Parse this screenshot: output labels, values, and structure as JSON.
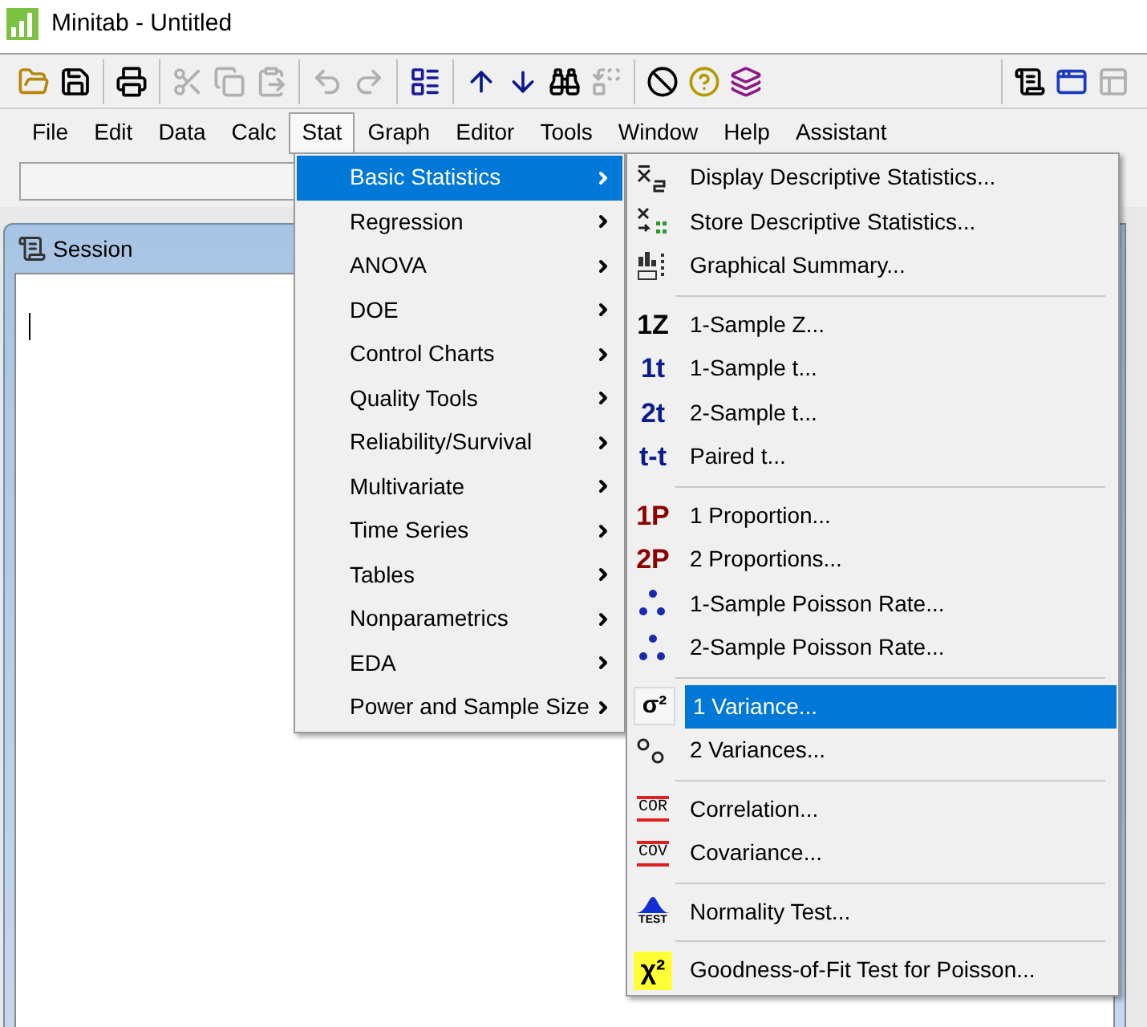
{
  "window": {
    "title": "Minitab - Untitled"
  },
  "toolbar": [
    {
      "kind": "open",
      "disabled": false
    },
    {
      "kind": "save",
      "disabled": false
    },
    {
      "kind": "sep"
    },
    {
      "kind": "print",
      "disabled": false
    },
    {
      "kind": "sep"
    },
    {
      "kind": "cut",
      "disabled": true
    },
    {
      "kind": "copy",
      "disabled": true
    },
    {
      "kind": "paste",
      "disabled": true
    },
    {
      "kind": "sep"
    },
    {
      "kind": "undo",
      "disabled": true
    },
    {
      "kind": "redo",
      "disabled": true
    },
    {
      "kind": "sep"
    },
    {
      "kind": "sheet",
      "disabled": false
    },
    {
      "kind": "sep"
    },
    {
      "kind": "up",
      "disabled": false
    },
    {
      "kind": "down",
      "disabled": false
    },
    {
      "kind": "find",
      "disabled": false
    },
    {
      "kind": "replace",
      "disabled": true
    },
    {
      "kind": "sep"
    },
    {
      "kind": "cancel",
      "disabled": false
    },
    {
      "kind": "help",
      "disabled": false
    },
    {
      "kind": "stack",
      "disabled": false
    }
  ],
  "toolbar_right": [
    {
      "kind": "session",
      "disabled": false
    },
    {
      "kind": "windows",
      "disabled": false
    },
    {
      "kind": "graphs",
      "disabled": true
    }
  ],
  "menubar": [
    {
      "label": "File",
      "selected": false
    },
    {
      "label": "Edit",
      "selected": false
    },
    {
      "label": "Data",
      "selected": false
    },
    {
      "label": "Calc",
      "selected": false
    },
    {
      "label": "Stat",
      "selected": true
    },
    {
      "label": "Graph",
      "selected": false
    },
    {
      "label": "Editor",
      "selected": false
    },
    {
      "label": "Tools",
      "selected": false
    },
    {
      "label": "Window",
      "selected": false
    },
    {
      "label": "Help",
      "selected": false
    },
    {
      "label": "Assistant",
      "selected": false
    }
  ],
  "session": {
    "title": "Session"
  },
  "stat_menu": [
    {
      "label": "Basic Statistics",
      "selected": true
    },
    {
      "label": "Regression",
      "selected": false
    },
    {
      "label": "ANOVA",
      "selected": false
    },
    {
      "label": "DOE",
      "selected": false
    },
    {
      "label": "Control Charts",
      "selected": false
    },
    {
      "label": "Quality Tools",
      "selected": false
    },
    {
      "label": "Reliability/Survival",
      "selected": false
    },
    {
      "label": "Multivariate",
      "selected": false
    },
    {
      "label": "Time Series",
      "selected": false
    },
    {
      "label": "Tables",
      "selected": false
    },
    {
      "label": "Nonparametrics",
      "selected": false
    },
    {
      "label": "EDA",
      "selected": false
    },
    {
      "label": "Power and Sample Size",
      "selected": false
    }
  ],
  "basic_statistics_menu": [
    {
      "kind": "item",
      "label": "Display Descriptive Statistics...",
      "selected": false,
      "icon": {
        "kind": "xs"
      }
    },
    {
      "kind": "item",
      "label": "Store Descriptive Statistics...",
      "selected": false,
      "icon": {
        "kind": "store"
      }
    },
    {
      "kind": "item",
      "label": "Graphical Summary...",
      "selected": false,
      "icon": {
        "kind": "graph"
      }
    },
    {
      "kind": "separator"
    },
    {
      "kind": "item",
      "label": "1-Sample Z...",
      "selected": false,
      "icon": {
        "kind": "black",
        "text": "1Z"
      }
    },
    {
      "kind": "item",
      "label": "1-Sample t...",
      "selected": false,
      "icon": {
        "kind": "blue",
        "text": "1t"
      }
    },
    {
      "kind": "item",
      "label": "2-Sample t...",
      "selected": false,
      "icon": {
        "kind": "blue",
        "text": "2t"
      }
    },
    {
      "kind": "item",
      "label": "Paired t...",
      "selected": false,
      "icon": {
        "kind": "blue",
        "text": "t-t"
      }
    },
    {
      "kind": "separator"
    },
    {
      "kind": "item",
      "label": "1 Proportion...",
      "selected": false,
      "icon": {
        "kind": "red",
        "text": "1P"
      }
    },
    {
      "kind": "item",
      "label": "2 Proportions...",
      "selected": false,
      "icon": {
        "kind": "red",
        "text": "2P"
      }
    },
    {
      "kind": "item",
      "label": "1-Sample Poisson Rate...",
      "selected": false,
      "icon": {
        "kind": "poisson"
      }
    },
    {
      "kind": "item",
      "label": "2-Sample Poisson Rate...",
      "selected": false,
      "icon": {
        "kind": "poisson"
      }
    },
    {
      "kind": "separator"
    },
    {
      "kind": "item",
      "label": "1 Variance...",
      "selected": true,
      "icon": {
        "kind": "sigma",
        "text": "σ²"
      }
    },
    {
      "kind": "item",
      "label": "2 Variances...",
      "selected": false,
      "icon": {
        "kind": "sigma2"
      }
    },
    {
      "kind": "separator"
    },
    {
      "kind": "item",
      "label": "Correlation...",
      "selected": false,
      "icon": {
        "kind": "boxed",
        "text": "COR"
      }
    },
    {
      "kind": "item",
      "label": "Covariance...",
      "selected": false,
      "icon": {
        "kind": "boxed",
        "text": "COV"
      }
    },
    {
      "kind": "separator"
    },
    {
      "kind": "item",
      "label": "Normality Test...",
      "selected": false,
      "icon": {
        "kind": "normal",
        "text": "TEST"
      }
    },
    {
      "kind": "separator"
    },
    {
      "kind": "item",
      "label": "Goodness-of-Fit Test for Poisson...",
      "selected": false,
      "icon": {
        "kind": "chi",
        "text": "χ²"
      }
    }
  ]
}
